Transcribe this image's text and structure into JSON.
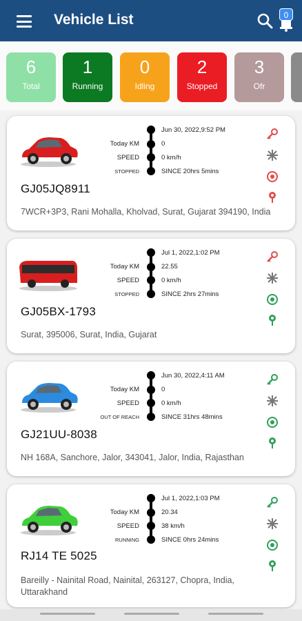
{
  "header": {
    "title": "Vehicle List",
    "notification_count": "0"
  },
  "filters": [
    {
      "num": "6",
      "label": "Total",
      "color": "#8fe0a6"
    },
    {
      "num": "1",
      "label": "Running",
      "color": "#0c7a23"
    },
    {
      "num": "0",
      "label": "Idling",
      "color": "#f7a21b"
    },
    {
      "num": "2",
      "label": "Stopped",
      "color": "#ea1c24"
    },
    {
      "num": "3",
      "label": "Ofr",
      "color": "#b49a9a"
    }
  ],
  "vehicles": [
    {
      "time": "Jun 30, 2022,9:52 PM",
      "today_km_label": "Today KM",
      "today_km": "0",
      "speed_label": "SPEED",
      "speed": "0  km/h",
      "status": "STOPPED",
      "since": "SINCE  20hrs 5mins",
      "reg": "GJ05JQ8911",
      "address": "7WCR+3P3, Rani Mohalla, Kholvad, Surat, Gujarat 394190, India",
      "vehicle_icon": "red-car",
      "state_color": "#e24b4b"
    },
    {
      "time": "Jul 1, 2022,1:02 PM",
      "today_km_label": "Today KM",
      "today_km": "22.55",
      "speed_label": "SPEED",
      "speed": "0  km/h",
      "status": "STOPPED",
      "since": "SINCE  2hrs 27mins",
      "reg": "GJ05BX-1793",
      "address": "Surat, 395006, Surat, India, Gujarat",
      "vehicle_icon": "red-bus",
      "state_color": "#e24b4b"
    },
    {
      "time": "Jun 30, 2022,4:11 AM",
      "today_km_label": "Today KM",
      "today_km": "0",
      "speed_label": "SPEED",
      "speed": "0  km/h",
      "status": "OUT OF REACH",
      "since": "SINCE  31hrs 48mins",
      "reg": "GJ21UU-8038",
      "address": "NH 168A, Sanchore, Jalor, 343041, Jalor, India, Rajasthan",
      "vehicle_icon": "blue-car",
      "state_color": "#2fa05a"
    },
    {
      "time": "Jul 1, 2022,1:03 PM",
      "today_km_label": "Today KM",
      "today_km": "20.34",
      "speed_label": "SPEED",
      "speed": "38  km/h",
      "status": "RUNNING",
      "since": "SINCE  0hrs 24mins",
      "reg": "RJ14 TE 5025",
      "address_line1": "Bareilly - Nainital Road, Nainital, 263127, Chopra, India,",
      "address_line2": "Uttarakhand",
      "vehicle_icon": "green-car",
      "state_color": "#2fa05a"
    }
  ]
}
